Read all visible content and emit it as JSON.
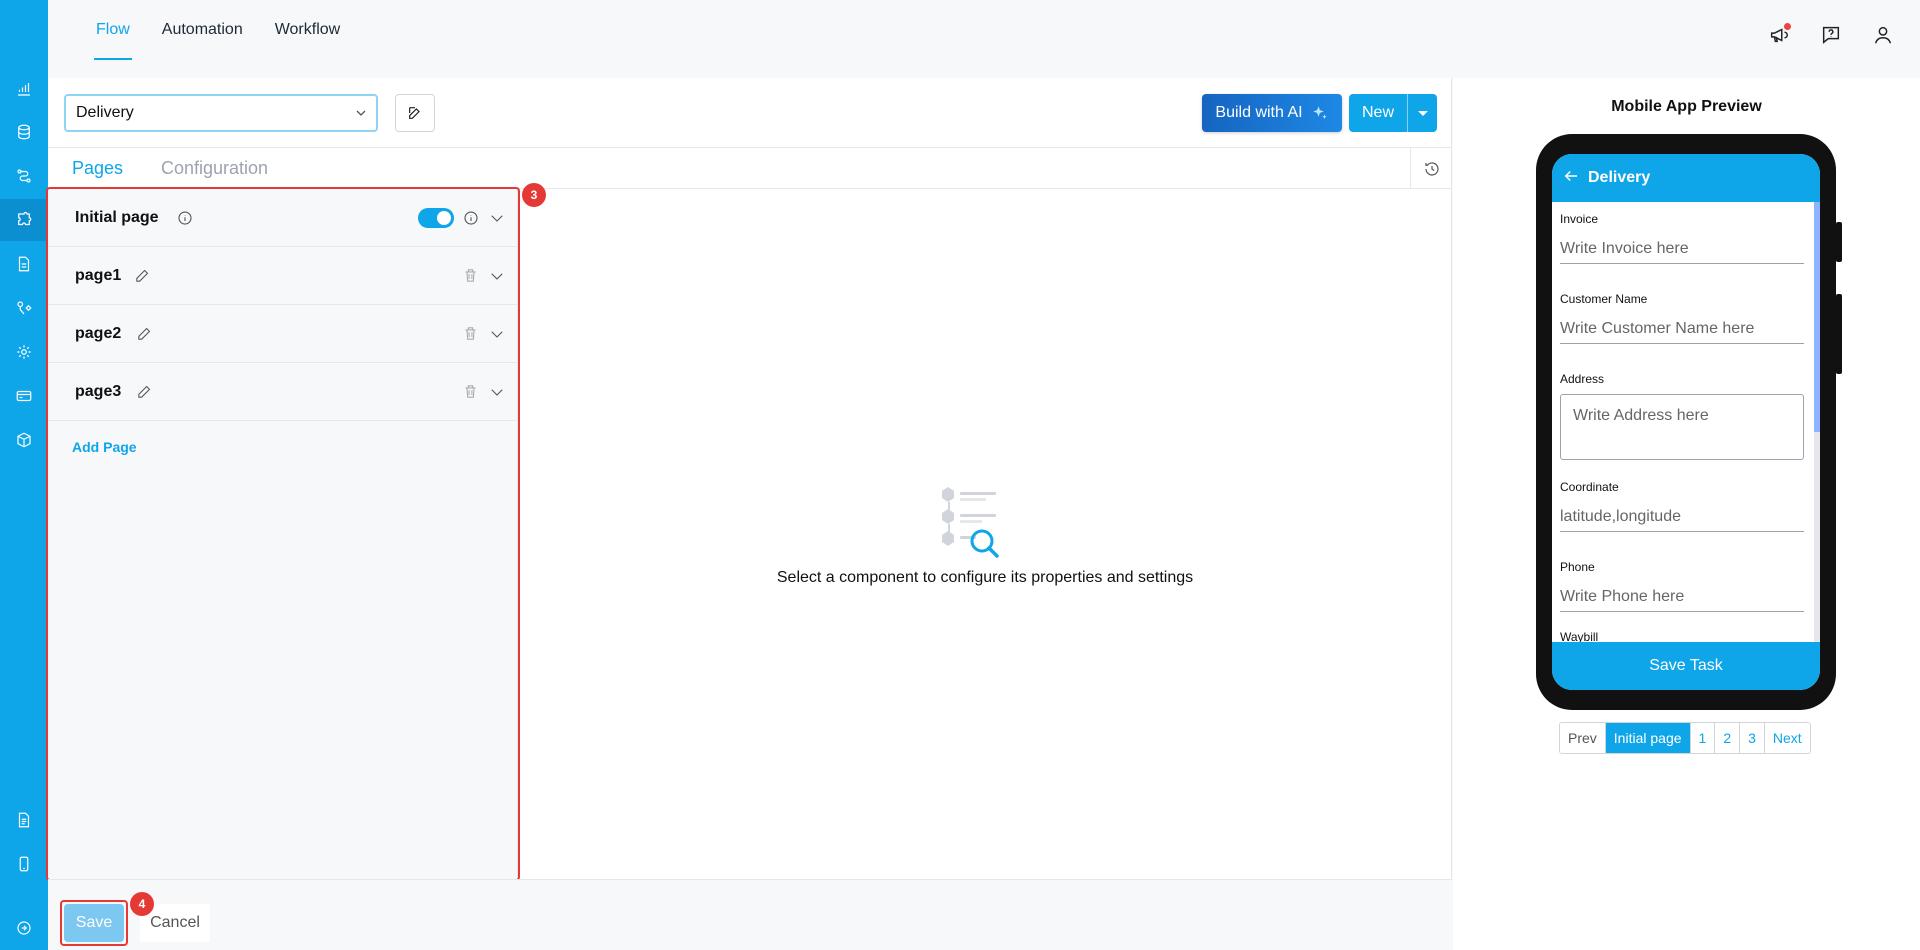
{
  "top_nav": {
    "tabs": [
      "Flow",
      "Automation",
      "Workflow"
    ],
    "active": "Flow"
  },
  "toolbar": {
    "flow_select_value": "Delivery",
    "build_ai_label": "Build with AI",
    "new_label": "New"
  },
  "subtabs": {
    "pages_label": "Pages",
    "config_label": "Configuration"
  },
  "pages": {
    "initial_label": "Initial page",
    "items": [
      {
        "name": "page1"
      },
      {
        "name": "page2"
      },
      {
        "name": "page3"
      }
    ],
    "add_page_label": "Add Page"
  },
  "empty_state": {
    "message": "Select a component to configure its properties and settings"
  },
  "footer": {
    "save_label": "Save",
    "cancel_label": "Cancel"
  },
  "annotations": {
    "pages_badge": "3",
    "save_badge": "4"
  },
  "preview": {
    "title": "Mobile App Preview",
    "screen_title": "Delivery",
    "fields": [
      {
        "label": "Invoice",
        "placeholder": "Write Invoice here"
      },
      {
        "label": "Customer Name",
        "placeholder": "Write Customer Name here"
      },
      {
        "label": "Address",
        "placeholder": "Write Address here"
      },
      {
        "label": "Coordinate",
        "placeholder": "latitude,longitude"
      },
      {
        "label": "Phone",
        "placeholder": "Write Phone here"
      },
      {
        "label": "Waybill",
        "placeholder": ""
      }
    ],
    "save_task_label": "Save Task",
    "pager": {
      "prev": "Prev",
      "initial": "Initial page",
      "pages": [
        "1",
        "2",
        "3"
      ],
      "next": "Next"
    }
  },
  "colors": {
    "accent": "#0ea5e9",
    "annotation": "#e53935"
  }
}
